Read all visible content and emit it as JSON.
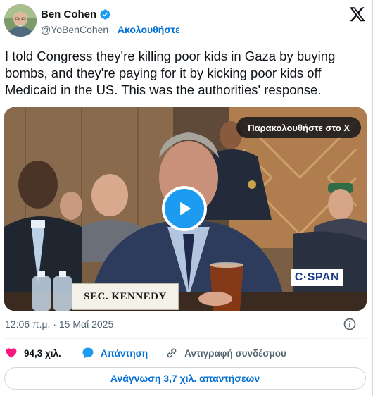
{
  "author": {
    "name": "Ben Cohen",
    "handle": "@YoBenCohen",
    "follow_label": "Ακολουθήστε"
  },
  "tweet": {
    "text": "I told Congress they're killing poor kids in Gaza by buying bombs, and they're paying for it by kicking poor kids off Medicaid in the US. This was the authorities' response.",
    "timestamp": "12:06 π.μ. · 15 Μαΐ 2025"
  },
  "media": {
    "watch_label": "Παρακολουθήστε στο X",
    "nameplate": "SEC. KENNEDY",
    "watermark": "C·SPAN"
  },
  "actions": {
    "likes": "94,3 χιλ.",
    "reply_label": "Απάντηση",
    "copy_label": "Αντιγραφή συνδέσμου"
  },
  "read_replies_label": "Ανάγνωση 3,7 χιλ. απαντήσεων",
  "colors": {
    "link": "#006fd6",
    "like": "#f91880",
    "verified": "#1d9bf0",
    "play": "#1d9bf0"
  }
}
